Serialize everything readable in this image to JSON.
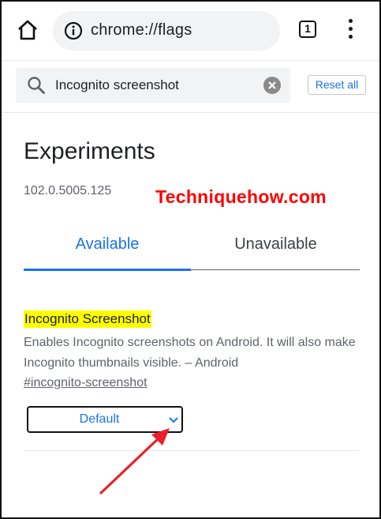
{
  "toolbar": {
    "url": "chrome://flags",
    "tab_count": "1",
    "icons": [
      "home-icon",
      "info-icon",
      "tab-switcher-icon",
      "more-vert-icon"
    ]
  },
  "search": {
    "value": "Incognito screenshot",
    "reset_label": "Reset all"
  },
  "page": {
    "title": "Experiments",
    "version": "102.0.5005.125",
    "watermark": "Techniquehow.com"
  },
  "tabs": [
    {
      "label": "Available",
      "selected": true
    },
    {
      "label": "Unavailable",
      "selected": false
    }
  ],
  "flag": {
    "title": "Incognito Screenshot",
    "description": "Enables Incognito screenshots on Android. It will also make Incognito thumbnails visible. – Android",
    "link": "#incognito-screenshot",
    "selected_option": "Default"
  },
  "colors": {
    "accent": "#1a73e8",
    "highlight": "#ffff00",
    "watermark": "#ff0000",
    "annotation_arrow": "#e8202a"
  }
}
